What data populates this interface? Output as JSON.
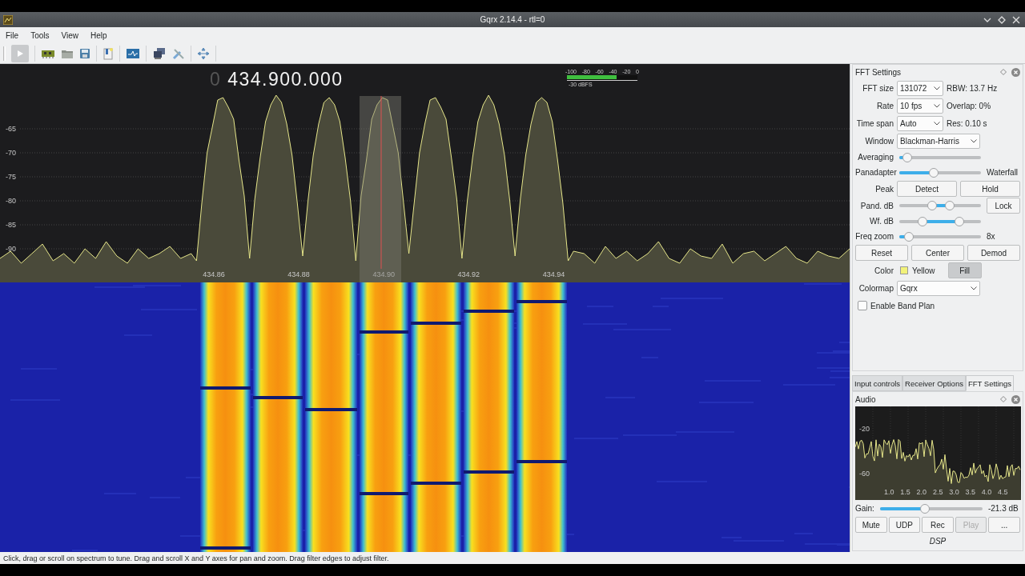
{
  "window": {
    "title": "Gqrx 2.14.4 - rtl=0"
  },
  "menu": [
    "File",
    "Tools",
    "View",
    "Help"
  ],
  "frequency": {
    "prefix": "0",
    "value": "434.900.000"
  },
  "level_meter": {
    "scale": [
      "-100",
      "-80",
      "-60",
      "-40",
      "-20",
      "0"
    ],
    "level": 0.7,
    "reading": "-30 dBFS"
  },
  "spectrum": {
    "chart_data": {
      "type": "area",
      "xlim": [
        434.81,
        435.01
      ],
      "ylim": [
        -97,
        -51.5
      ],
      "grid": true,
      "yticks": [
        {
          "value": -65,
          "label": "-65"
        },
        {
          "value": -70,
          "label": "-70"
        },
        {
          "value": -75,
          "label": "-75"
        },
        {
          "value": -80,
          "label": "-80"
        },
        {
          "value": -85,
          "label": "-85"
        },
        {
          "value": -90,
          "label": "-90"
        }
      ],
      "xticks": [
        {
          "value": 434.86,
          "label": "434.86"
        },
        {
          "value": 434.88,
          "label": "434.88"
        },
        {
          "value": 434.9,
          "label": "434.90"
        },
        {
          "value": 434.92,
          "label": "434.92"
        },
        {
          "value": 434.94,
          "label": "434.94"
        }
      ],
      "x": [
        434.81,
        434.8125,
        434.815,
        434.8175,
        434.82,
        434.8225,
        434.825,
        434.8275,
        434.83,
        434.8325,
        434.835,
        434.8375,
        434.84,
        434.8425,
        434.845,
        434.8475,
        434.85,
        434.8525,
        434.855,
        434.85625,
        434.8575,
        434.85875,
        434.86,
        434.86125,
        434.8625,
        434.86375,
        434.865,
        434.86625,
        434.8675,
        434.86875,
        434.87,
        434.87125,
        434.8725,
        434.87375,
        434.875,
        434.87625,
        434.8775,
        434.87875,
        434.88,
        434.88125,
        434.8825,
        434.88375,
        434.885,
        434.88625,
        434.8875,
        434.88875,
        434.89,
        434.89125,
        434.8925,
        434.89375,
        434.895,
        434.89625,
        434.8975,
        434.89875,
        434.9,
        434.90125,
        434.9025,
        434.90375,
        434.905,
        434.90625,
        434.9075,
        434.90875,
        434.91,
        434.91125,
        434.9125,
        434.91375,
        434.915,
        434.91625,
        434.9175,
        434.91875,
        434.92,
        434.92125,
        434.9225,
        434.92375,
        434.925,
        434.92625,
        434.9275,
        434.92875,
        434.93,
        434.93125,
        434.9325,
        434.93375,
        434.935,
        434.93625,
        434.9375,
        434.93875,
        434.94,
        434.94125,
        434.9425,
        434.94375,
        434.945,
        434.9475,
        434.95,
        434.9525,
        434.955,
        434.9575,
        434.96,
        434.9625,
        434.965,
        434.9675,
        434.97,
        434.9725,
        434.975,
        434.9775,
        434.98,
        434.9825,
        434.985,
        434.9875,
        434.99,
        434.9925,
        434.995,
        434.9975,
        435.0,
        435.0025,
        435.005,
        435.0075,
        435.01
      ],
      "series": [
        {
          "color": "#e6e68a",
          "values": [
            -92,
            -90.5,
            -93,
            -91,
            -89,
            -92.5,
            -91,
            -93,
            -90,
            -92,
            -88.5,
            -91.5,
            -93,
            -90,
            -92,
            -91,
            -89.5,
            -92,
            -91,
            -92.5,
            -80.5,
            -70,
            -64.5,
            -59,
            -58.5,
            -60.5,
            -63,
            -71.5,
            -79,
            -92,
            -79.5,
            -71,
            -63.5,
            -60,
            -58,
            -59.5,
            -64,
            -70.5,
            -80.5,
            -91.5,
            -80,
            -70.5,
            -64,
            -59.5,
            -58.5,
            -60,
            -63.5,
            -71,
            -80,
            -92.5,
            -79,
            -71.5,
            -63,
            -60,
            -58.5,
            -59,
            -64.5,
            -70,
            -80.5,
            -91,
            -80.5,
            -70,
            -64,
            -59,
            -58.5,
            -60.5,
            -63,
            -71,
            -79.5,
            -92,
            -80,
            -71,
            -63.5,
            -60,
            -58,
            -60,
            -64,
            -70.5,
            -80,
            -91.5,
            -79.5,
            -70.5,
            -64,
            -59.5,
            -58.5,
            -59.5,
            -63.5,
            -71.5,
            -80.5,
            -92.5,
            -90.5,
            -91,
            -93,
            -89.5,
            -92,
            -90.5,
            -92.5,
            -91,
            -88.5,
            -92,
            -93,
            -90,
            -91.5,
            -92,
            -89,
            -93,
            -91,
            -90.5,
            -92.5,
            -91,
            -89.5,
            -92,
            -93,
            -90.5,
            -91.5,
            -92,
            -90
          ]
        }
      ]
    }
  },
  "fft_settings": {
    "title": "FFT Settings",
    "rows": [
      {
        "kind": "select",
        "label": "FFT size",
        "value": "131072",
        "note": "RBW: 13.7 Hz"
      },
      {
        "kind": "select",
        "label": "Rate",
        "value": "10 fps",
        "note": "Overlap: 0%"
      },
      {
        "kind": "select",
        "label": "Time span",
        "value": "Auto",
        "note": "Res: 0.10 s"
      },
      {
        "kind": "select",
        "label": "Window",
        "value": "Blackman-Harris"
      },
      {
        "kind": "slider",
        "label": "Averaging",
        "level": 0.1
      },
      {
        "kind": "slider",
        "label": "Panadapter",
        "level": 0.42,
        "end": "Waterfall"
      },
      {
        "kind": "buttons",
        "label": "Peak",
        "buttons": [
          "Detect",
          "Hold"
        ]
      },
      {
        "kind": "range",
        "label": "Pand. dB",
        "handles": [
          {
            "level": 0.4
          },
          {
            "level": 0.62
          }
        ],
        "button": "Lock"
      },
      {
        "kind": "range",
        "label": "Wf. dB",
        "handles": [
          {
            "level": 0.28
          },
          {
            "level": 0.74
          }
        ]
      },
      {
        "kind": "slider",
        "label": "Freq zoom",
        "level": 0.12,
        "end": "8x"
      },
      {
        "kind": "buttons",
        "buttons": [
          "Reset",
          "Center",
          "Demod"
        ]
      },
      {
        "kind": "color",
        "label": "Color",
        "color": "#f2f27a",
        "name": "Yellow",
        "button": {
          "label": "Fill",
          "pressed": true
        }
      },
      {
        "kind": "select",
        "label": "Colormap",
        "value": "Gqrx"
      },
      {
        "kind": "checkbox",
        "label": "Enable Band Plan",
        "checked": false
      }
    ]
  },
  "tabs": [
    {
      "label": "Input controls",
      "selected": false
    },
    {
      "label": "Receiver Options",
      "selected": false
    },
    {
      "label": "FFT Settings",
      "selected": true
    }
  ],
  "audio": {
    "title": "Audio",
    "y_labels": [
      "-20",
      "-60"
    ],
    "x_labels": [
      "1.0",
      "1.5",
      "2.0",
      "2.5",
      "3.0",
      "3.5",
      "4.0",
      "4.5"
    ],
    "gain_label": "Gain:",
    "gain": {
      "level": 0.44
    },
    "gain_reading": "-21.3 dB",
    "buttons": [
      {
        "label": "Mute",
        "disabled": false
      },
      {
        "label": "UDP",
        "disabled": false
      },
      {
        "label": "Rec",
        "disabled": false
      },
      {
        "label": "Play",
        "disabled": true
      },
      {
        "label": "...",
        "disabled": false
      }
    ],
    "footer": "DSP"
  },
  "status_bar": "Click, drag or scroll on spectrum to tune. Drag and scroll X and Y axes for pan and zoom. Drag filter edges to adjust filter."
}
